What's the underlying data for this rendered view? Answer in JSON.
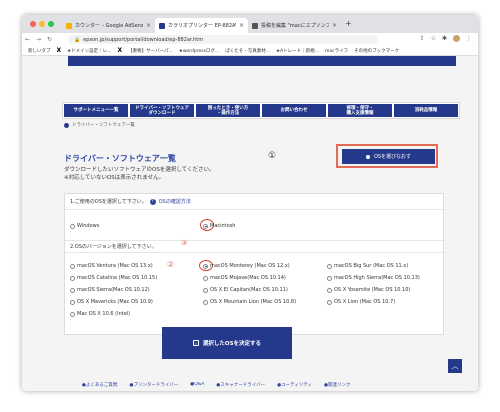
{
  "browser": {
    "tabs": [
      {
        "title": "カウンター – Google AdSense",
        "favicon_color": "#f4b400"
      },
      {
        "title": "カラリオプリンター EP-882AW",
        "favicon_color": "#25398c"
      },
      {
        "title": "投稿を編集 \"macにエプソンプリ",
        "favicon_color": "#555555"
      }
    ],
    "address": "epson.jp/support/portal/download/ep-882ar.htm",
    "bookmarks": [
      "新しいタブ",
      "★ドメイン設定｜レ...",
      "【重要】サーバーパ...",
      "★wordpressログ...",
      "ぱくたそ - 写真素材...",
      "★Aトレード｜新規...",
      "macライフ",
      "その他のブックマーク"
    ]
  },
  "nav": {
    "items": [
      "サポートメニュー一覧",
      "ドライバー・ソフトウェア\nダウンロード",
      "困ったとき・使い方\n・操作方法",
      "お問い合わせ",
      "修理・保守・\n購入支援情報",
      "消耗品情報"
    ]
  },
  "breadcrumb": "ドライバー・ソフトウェア一覧",
  "heading": {
    "title": "ドライバー・ソフトウェア一覧",
    "desc1": "ダウンロードしたいソフトウェアのOSを選択してください。",
    "desc2": "※対応していないOSは表示されません。"
  },
  "annotations": {
    "one": "①",
    "two": "②",
    "three": "③"
  },
  "choose_os_button": "OSを選びなおす",
  "os_select": {
    "question": "1.ご使用のOSを選択して下さい。",
    "help_link": "OSの確認方法",
    "options": [
      {
        "label": "Windows",
        "selected": false
      },
      {
        "label": "Macintosh",
        "selected": true
      }
    ]
  },
  "version_select": {
    "question": "2.OSのバージョンを選択して下さい。",
    "options": [
      {
        "label": "macOS Ventura (Mac OS 13.x)",
        "selected": false
      },
      {
        "label": "macOS Monterey (Mac OS 12.x)",
        "selected": true
      },
      {
        "label": "macOS Big Sur (Mac OS 11.x)",
        "selected": false
      },
      {
        "label": "macOS Catalina (Mac OS 10.15)",
        "selected": false
      },
      {
        "label": "macOS Mojave(Mac OS 10.14)",
        "selected": false
      },
      {
        "label": "macOS High Sierra(Mac OS 10.13)",
        "selected": false
      },
      {
        "label": "macOS Sierra(Mac OS 10.12)",
        "selected": false
      },
      {
        "label": "OS X El Capitan(Mac OS 10.11)",
        "selected": false
      },
      {
        "label": "OS X Yosemite (Mac OS 10.10)",
        "selected": false
      },
      {
        "label": "OS X Mavericks (Mac OS 10.9)",
        "selected": false
      },
      {
        "label": "OS X Mountain Lion (Mac OS 10.8)",
        "selected": false
      },
      {
        "label": "OS X Lion (Mac OS 10.7)",
        "selected": false
      },
      {
        "label": "Mac OS X 10.6 (Intel)",
        "selected": false
      }
    ]
  },
  "decide_button": "選択したOSを決定する",
  "footer_links": [
    "●よくあるご質問",
    "●プリンタードライバー",
    "●Q&A",
    "●スキャナードライバー",
    "●ユーティリティ",
    "●関連リンク"
  ],
  "colors": {
    "brand": "#25398c",
    "annotation": "#e46a55"
  }
}
